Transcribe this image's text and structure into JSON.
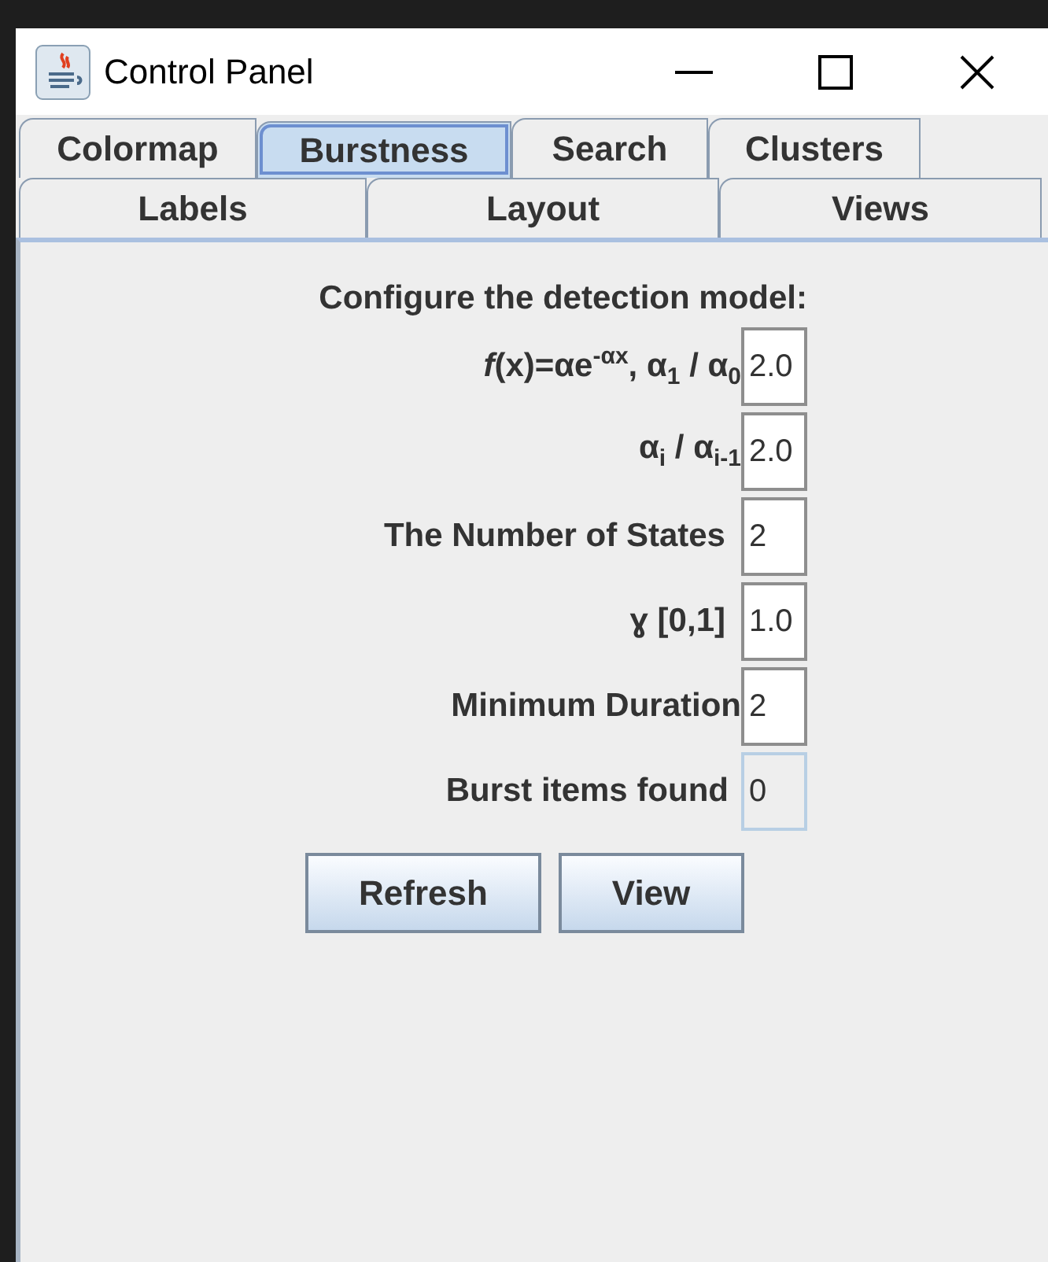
{
  "window": {
    "title": "Control Panel"
  },
  "tab_rows": [
    [
      {
        "label": "Colormap",
        "selected": false
      },
      {
        "label": "Burstness",
        "selected": true
      },
      {
        "label": "Search",
        "selected": false
      },
      {
        "label": "Clusters",
        "selected": false
      }
    ],
    [
      {
        "label": "Labels",
        "selected": false
      },
      {
        "label": "Layout",
        "selected": false
      },
      {
        "label": "Views",
        "selected": false
      }
    ]
  ],
  "heading": "Configure the detection model:",
  "fields": [
    {
      "label": "*f*(x)=αe$^{-αx}$, α$_{1}$ / α$_{0}$",
      "value": "2.0",
      "disabled": false
    },
    {
      "label": "α$_{i}$ / α$_{i-1}$",
      "value": "2.0",
      "disabled": false
    },
    {
      "label": "The Number of States",
      "value": "2",
      "disabled": false
    },
    {
      "label": "ɣ [0,1]",
      "value": "1.0",
      "disabled": false
    },
    {
      "label": "Minimum Duration",
      "value": "2",
      "disabled": false
    },
    {
      "label": "Burst items found",
      "value": "0",
      "disabled": true
    }
  ],
  "buttons": [
    "Refresh",
    "View"
  ]
}
